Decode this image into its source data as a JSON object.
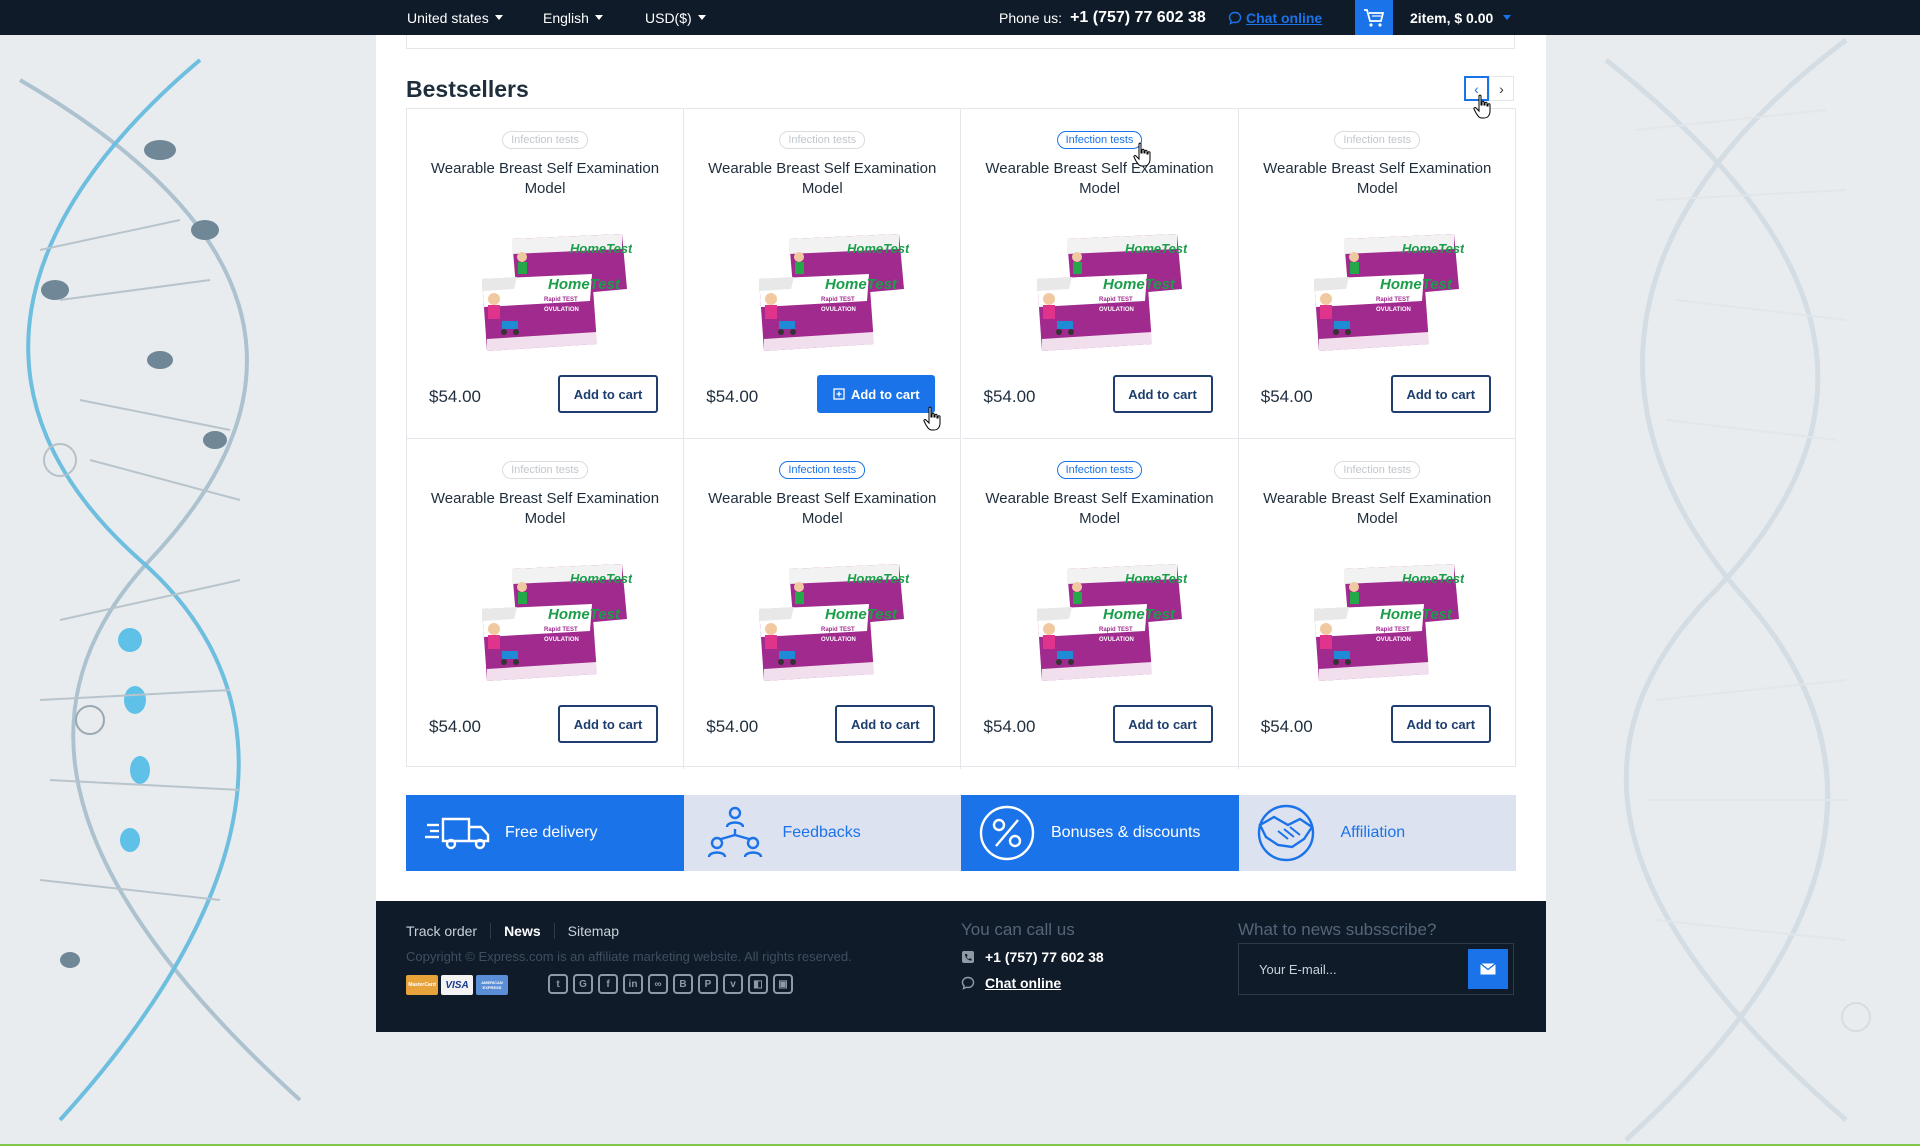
{
  "topbar": {
    "country": "United states",
    "language": "English",
    "currency": "USD($)",
    "phone_label": "Phone us:",
    "phone_number": "+1 (757) 77 602 38",
    "chat_label": "Chat online",
    "cart_summary": "2item, $ 0.00"
  },
  "bestsellers": {
    "title": "Bestsellers",
    "prev_label": "‹",
    "next_label": "›"
  },
  "products": [
    {
      "badge": "Infection tests",
      "name": "Wearable Breast Self Examination Model",
      "price": "$54.00",
      "button": "Add to cart"
    },
    {
      "badge": "Infection tests",
      "name": "Wearable Breast Self Examination Model",
      "price": "$54.00",
      "button": "Add to cart"
    },
    {
      "badge": "Infection tests",
      "name": "Wearable Breast Self Examination Model",
      "price": "$54.00",
      "button": "Add to cart"
    },
    {
      "badge": "Infection tests",
      "name": "Wearable Breast Self Examination Model",
      "price": "$54.00",
      "button": "Add to cart"
    },
    {
      "badge": "Infection tests",
      "name": "Wearable Breast Self Examination Model",
      "price": "$54.00",
      "button": "Add to cart"
    },
    {
      "badge": "Infection tests",
      "name": "Wearable Breast Self Examination Model",
      "price": "$54.00",
      "button": "Add to cart"
    },
    {
      "badge": "Infection tests",
      "name": "Wearable Breast Self Examination Model",
      "price": "$54.00",
      "button": "Add to cart"
    },
    {
      "badge": "Infection tests",
      "name": "Wearable Breast Self Examination Model",
      "price": "$54.00",
      "button": "Add to cart"
    }
  ],
  "product_image_text": {
    "brand": "HomeTest",
    "line1": "Rapid TEST",
    "line2": "OVULATION"
  },
  "features": [
    {
      "label": "Free delivery",
      "icon": "truck-icon"
    },
    {
      "label": "Feedbacks",
      "icon": "people-network-icon"
    },
    {
      "label": "Bonuses & discounts",
      "icon": "percent-icon"
    },
    {
      "label": "Affiliation",
      "icon": "handshake-icon"
    }
  ],
  "footer": {
    "links": [
      "Track order",
      "News",
      "Sitemap"
    ],
    "copyright": "Copyright © Express.com is an affiliate marketing website. All rights reserved.",
    "payments": [
      "MasterCard",
      "VISA",
      "AMERICAN EXPRESS"
    ],
    "social_icons": [
      "twitter-icon",
      "google-plus-icon",
      "facebook-icon",
      "linkedin-icon",
      "link-icon",
      "blogger-icon",
      "pinterest-icon",
      "vimeo-icon",
      "delicious-icon",
      "digg-icon"
    ],
    "call_title": "You can call us",
    "call_phone": "+1 (757) 77 602 38",
    "call_chat": "Chat online",
    "news_title": "What to news subsscribe?",
    "email_placeholder": "Your E-mail..."
  },
  "colors": {
    "accent": "#1a73e8",
    "dark": "#0f1b28",
    "light_feature": "#dde2f0"
  }
}
